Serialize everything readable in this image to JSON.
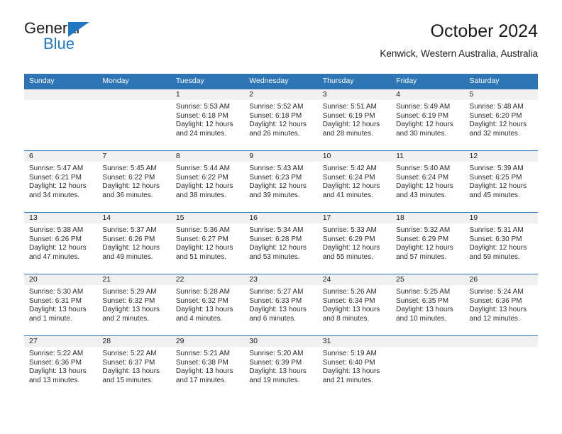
{
  "brand": {
    "name_part1": "General",
    "name_part2": "Blue",
    "accent_color": "#1f78c1"
  },
  "header": {
    "title": "October 2024",
    "location": "Kenwick, Western Australia, Australia"
  },
  "theme": {
    "header_blue": "#2e75b6",
    "daynum_bg": "#f0f0f0"
  },
  "weekdays": [
    "Sunday",
    "Monday",
    "Tuesday",
    "Wednesday",
    "Thursday",
    "Friday",
    "Saturday"
  ],
  "weeks": [
    [
      {
        "day": "",
        "sunrise": "",
        "sunset": "",
        "daylight1": "",
        "daylight2": ""
      },
      {
        "day": "",
        "sunrise": "",
        "sunset": "",
        "daylight1": "",
        "daylight2": ""
      },
      {
        "day": "1",
        "sunrise": "Sunrise: 5:53 AM",
        "sunset": "Sunset: 6:18 PM",
        "daylight1": "Daylight: 12 hours",
        "daylight2": "and 24 minutes."
      },
      {
        "day": "2",
        "sunrise": "Sunrise: 5:52 AM",
        "sunset": "Sunset: 6:18 PM",
        "daylight1": "Daylight: 12 hours",
        "daylight2": "and 26 minutes."
      },
      {
        "day": "3",
        "sunrise": "Sunrise: 5:51 AM",
        "sunset": "Sunset: 6:19 PM",
        "daylight1": "Daylight: 12 hours",
        "daylight2": "and 28 minutes."
      },
      {
        "day": "4",
        "sunrise": "Sunrise: 5:49 AM",
        "sunset": "Sunset: 6:19 PM",
        "daylight1": "Daylight: 12 hours",
        "daylight2": "and 30 minutes."
      },
      {
        "day": "5",
        "sunrise": "Sunrise: 5:48 AM",
        "sunset": "Sunset: 6:20 PM",
        "daylight1": "Daylight: 12 hours",
        "daylight2": "and 32 minutes."
      }
    ],
    [
      {
        "day": "6",
        "sunrise": "Sunrise: 5:47 AM",
        "sunset": "Sunset: 6:21 PM",
        "daylight1": "Daylight: 12 hours",
        "daylight2": "and 34 minutes."
      },
      {
        "day": "7",
        "sunrise": "Sunrise: 5:45 AM",
        "sunset": "Sunset: 6:22 PM",
        "daylight1": "Daylight: 12 hours",
        "daylight2": "and 36 minutes."
      },
      {
        "day": "8",
        "sunrise": "Sunrise: 5:44 AM",
        "sunset": "Sunset: 6:22 PM",
        "daylight1": "Daylight: 12 hours",
        "daylight2": "and 38 minutes."
      },
      {
        "day": "9",
        "sunrise": "Sunrise: 5:43 AM",
        "sunset": "Sunset: 6:23 PM",
        "daylight1": "Daylight: 12 hours",
        "daylight2": "and 39 minutes."
      },
      {
        "day": "10",
        "sunrise": "Sunrise: 5:42 AM",
        "sunset": "Sunset: 6:24 PM",
        "daylight1": "Daylight: 12 hours",
        "daylight2": "and 41 minutes."
      },
      {
        "day": "11",
        "sunrise": "Sunrise: 5:40 AM",
        "sunset": "Sunset: 6:24 PM",
        "daylight1": "Daylight: 12 hours",
        "daylight2": "and 43 minutes."
      },
      {
        "day": "12",
        "sunrise": "Sunrise: 5:39 AM",
        "sunset": "Sunset: 6:25 PM",
        "daylight1": "Daylight: 12 hours",
        "daylight2": "and 45 minutes."
      }
    ],
    [
      {
        "day": "13",
        "sunrise": "Sunrise: 5:38 AM",
        "sunset": "Sunset: 6:26 PM",
        "daylight1": "Daylight: 12 hours",
        "daylight2": "and 47 minutes."
      },
      {
        "day": "14",
        "sunrise": "Sunrise: 5:37 AM",
        "sunset": "Sunset: 6:26 PM",
        "daylight1": "Daylight: 12 hours",
        "daylight2": "and 49 minutes."
      },
      {
        "day": "15",
        "sunrise": "Sunrise: 5:36 AM",
        "sunset": "Sunset: 6:27 PM",
        "daylight1": "Daylight: 12 hours",
        "daylight2": "and 51 minutes."
      },
      {
        "day": "16",
        "sunrise": "Sunrise: 5:34 AM",
        "sunset": "Sunset: 6:28 PM",
        "daylight1": "Daylight: 12 hours",
        "daylight2": "and 53 minutes."
      },
      {
        "day": "17",
        "sunrise": "Sunrise: 5:33 AM",
        "sunset": "Sunset: 6:29 PM",
        "daylight1": "Daylight: 12 hours",
        "daylight2": "and 55 minutes."
      },
      {
        "day": "18",
        "sunrise": "Sunrise: 5:32 AM",
        "sunset": "Sunset: 6:29 PM",
        "daylight1": "Daylight: 12 hours",
        "daylight2": "and 57 minutes."
      },
      {
        "day": "19",
        "sunrise": "Sunrise: 5:31 AM",
        "sunset": "Sunset: 6:30 PM",
        "daylight1": "Daylight: 12 hours",
        "daylight2": "and 59 minutes."
      }
    ],
    [
      {
        "day": "20",
        "sunrise": "Sunrise: 5:30 AM",
        "sunset": "Sunset: 6:31 PM",
        "daylight1": "Daylight: 13 hours",
        "daylight2": "and 1 minute."
      },
      {
        "day": "21",
        "sunrise": "Sunrise: 5:29 AM",
        "sunset": "Sunset: 6:32 PM",
        "daylight1": "Daylight: 13 hours",
        "daylight2": "and 2 minutes."
      },
      {
        "day": "22",
        "sunrise": "Sunrise: 5:28 AM",
        "sunset": "Sunset: 6:32 PM",
        "daylight1": "Daylight: 13 hours",
        "daylight2": "and 4 minutes."
      },
      {
        "day": "23",
        "sunrise": "Sunrise: 5:27 AM",
        "sunset": "Sunset: 6:33 PM",
        "daylight1": "Daylight: 13 hours",
        "daylight2": "and 6 minutes."
      },
      {
        "day": "24",
        "sunrise": "Sunrise: 5:26 AM",
        "sunset": "Sunset: 6:34 PM",
        "daylight1": "Daylight: 13 hours",
        "daylight2": "and 8 minutes."
      },
      {
        "day": "25",
        "sunrise": "Sunrise: 5:25 AM",
        "sunset": "Sunset: 6:35 PM",
        "daylight1": "Daylight: 13 hours",
        "daylight2": "and 10 minutes."
      },
      {
        "day": "26",
        "sunrise": "Sunrise: 5:24 AM",
        "sunset": "Sunset: 6:36 PM",
        "daylight1": "Daylight: 13 hours",
        "daylight2": "and 12 minutes."
      }
    ],
    [
      {
        "day": "27",
        "sunrise": "Sunrise: 5:22 AM",
        "sunset": "Sunset: 6:36 PM",
        "daylight1": "Daylight: 13 hours",
        "daylight2": "and 13 minutes."
      },
      {
        "day": "28",
        "sunrise": "Sunrise: 5:22 AM",
        "sunset": "Sunset: 6:37 PM",
        "daylight1": "Daylight: 13 hours",
        "daylight2": "and 15 minutes."
      },
      {
        "day": "29",
        "sunrise": "Sunrise: 5:21 AM",
        "sunset": "Sunset: 6:38 PM",
        "daylight1": "Daylight: 13 hours",
        "daylight2": "and 17 minutes."
      },
      {
        "day": "30",
        "sunrise": "Sunrise: 5:20 AM",
        "sunset": "Sunset: 6:39 PM",
        "daylight1": "Daylight: 13 hours",
        "daylight2": "and 19 minutes."
      },
      {
        "day": "31",
        "sunrise": "Sunrise: 5:19 AM",
        "sunset": "Sunset: 6:40 PM",
        "daylight1": "Daylight: 13 hours",
        "daylight2": "and 21 minutes."
      },
      {
        "day": "",
        "sunrise": "",
        "sunset": "",
        "daylight1": "",
        "daylight2": ""
      },
      {
        "day": "",
        "sunrise": "",
        "sunset": "",
        "daylight1": "",
        "daylight2": ""
      }
    ]
  ]
}
